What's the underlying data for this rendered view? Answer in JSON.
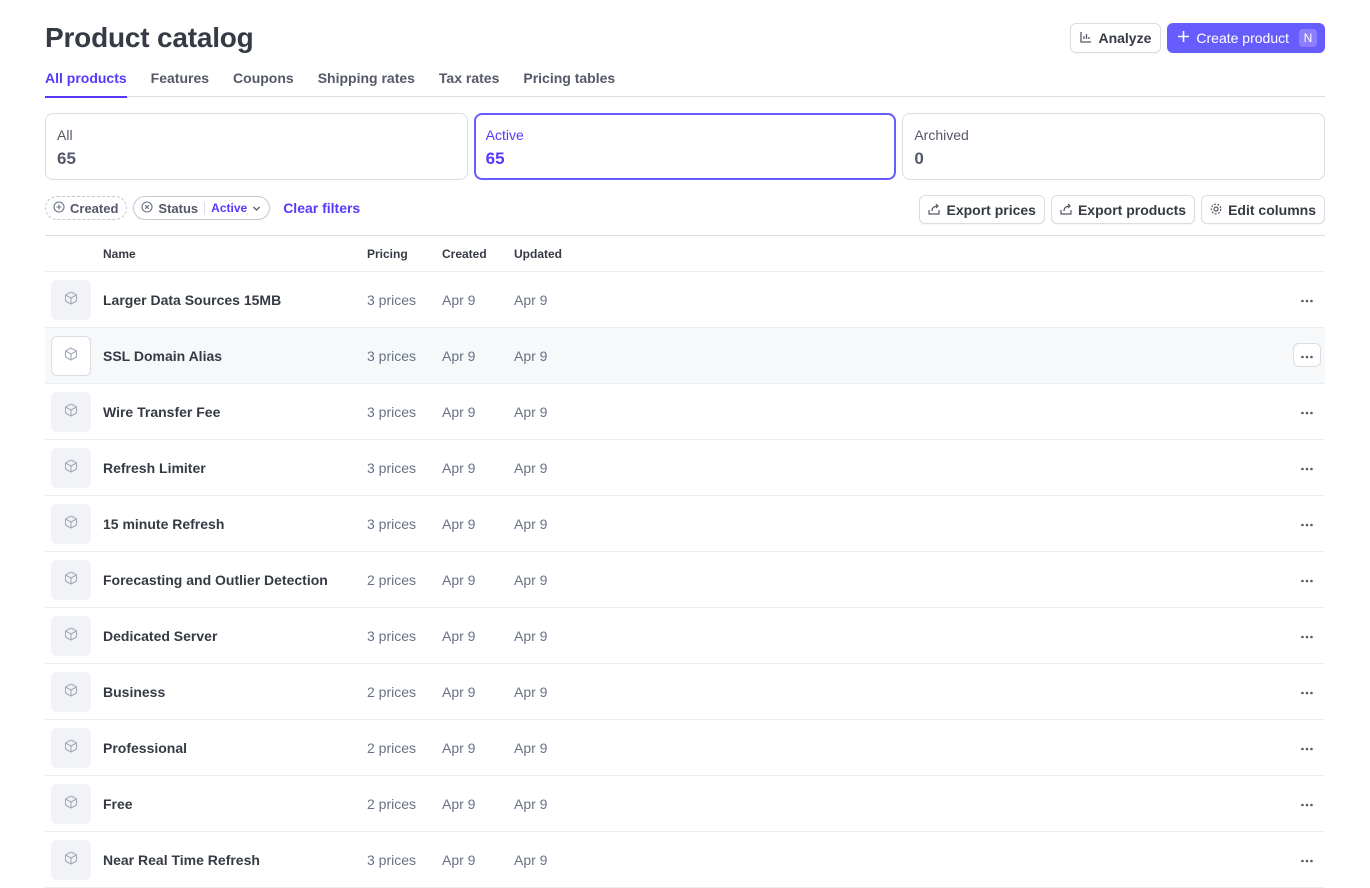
{
  "header": {
    "title": "Product catalog",
    "analyze_label": "Analyze",
    "create_label": "Create product",
    "create_shortcut": "N"
  },
  "tabs": [
    {
      "label": "All products",
      "active": true
    },
    {
      "label": "Features"
    },
    {
      "label": "Coupons"
    },
    {
      "label": "Shipping rates"
    },
    {
      "label": "Tax rates"
    },
    {
      "label": "Pricing tables"
    }
  ],
  "status_cards": [
    {
      "label": "All",
      "count": "65"
    },
    {
      "label": "Active",
      "count": "65",
      "selected": true
    },
    {
      "label": "Archived",
      "count": "0"
    }
  ],
  "filters": {
    "created_label": "Created",
    "status_label": "Status",
    "status_value": "Active",
    "clear_label": "Clear filters"
  },
  "actions": {
    "export_prices": "Export prices",
    "export_products": "Export products",
    "edit_columns": "Edit columns"
  },
  "table": {
    "columns": {
      "name": "Name",
      "pricing": "Pricing",
      "created": "Created",
      "updated": "Updated"
    },
    "rows": [
      {
        "name": "Larger Data Sources 15MB",
        "pricing": "3 prices",
        "created": "Apr 9",
        "updated": "Apr 9"
      },
      {
        "name": "SSL Domain Alias",
        "pricing": "3 prices",
        "created": "Apr 9",
        "updated": "Apr 9",
        "hover": true
      },
      {
        "name": "Wire Transfer Fee",
        "pricing": "3 prices",
        "created": "Apr 9",
        "updated": "Apr 9"
      },
      {
        "name": "Refresh Limiter",
        "pricing": "3 prices",
        "created": "Apr 9",
        "updated": "Apr 9"
      },
      {
        "name": "15 minute Refresh",
        "pricing": "3 prices",
        "created": "Apr 9",
        "updated": "Apr 9"
      },
      {
        "name": "Forecasting and Outlier Detection",
        "pricing": "2 prices",
        "created": "Apr 9",
        "updated": "Apr 9"
      },
      {
        "name": "Dedicated Server",
        "pricing": "3 prices",
        "created": "Apr 9",
        "updated": "Apr 9"
      },
      {
        "name": "Business",
        "pricing": "2 prices",
        "created": "Apr 9",
        "updated": "Apr 9"
      },
      {
        "name": "Professional",
        "pricing": "2 prices",
        "created": "Apr 9",
        "updated": "Apr 9"
      },
      {
        "name": "Free",
        "pricing": "2 prices",
        "created": "Apr 9",
        "updated": "Apr 9"
      },
      {
        "name": "Near Real Time Refresh",
        "pricing": "3 prices",
        "created": "Apr 9",
        "updated": "Apr 9"
      }
    ]
  },
  "colors": {
    "accent": "#533afd",
    "primary_button": "#675dff",
    "border": "#d8dee4",
    "row_hover": "#f6f8fa"
  },
  "icons": {
    "analyze": "bar-chart-icon",
    "create": "plus-icon",
    "created_filter": "plus-circle-icon",
    "status_filter": "x-circle-icon",
    "status_dropdown": "chevron-down-icon",
    "export": "export-icon",
    "edit_columns": "gear-icon",
    "product": "box-icon",
    "row_menu": "more-icon"
  }
}
